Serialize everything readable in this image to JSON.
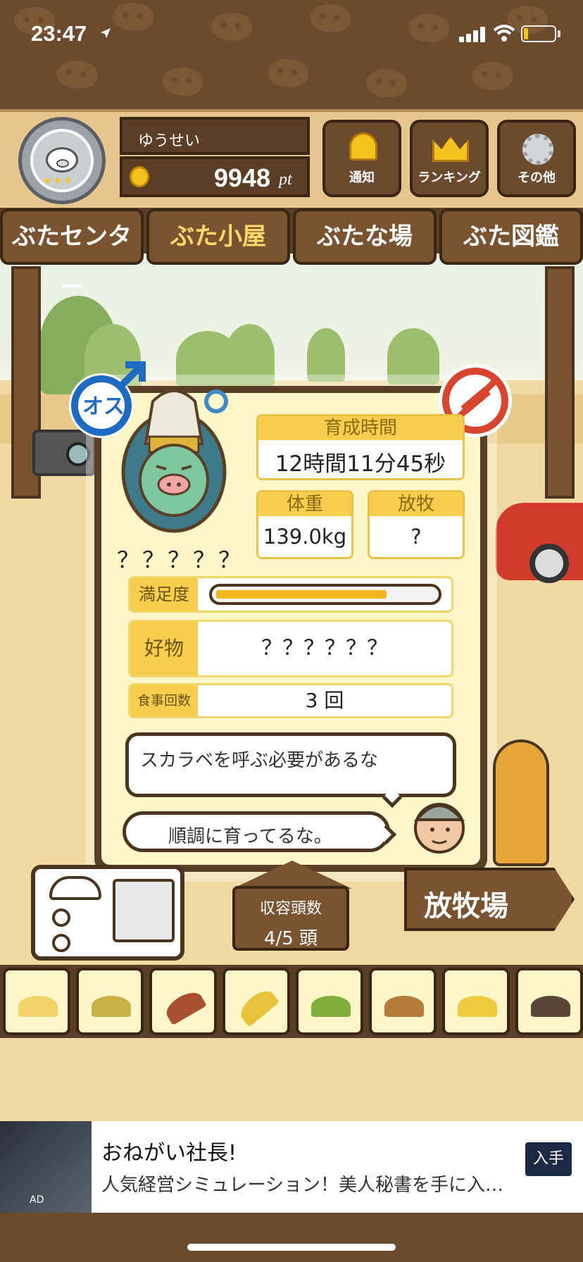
{
  "status_bar": {
    "time": "23:47"
  },
  "header": {
    "username": "ゆうせい",
    "points": "9948",
    "points_unit": "pt",
    "buttons": [
      {
        "label": "通知",
        "icon": "bell-icon"
      },
      {
        "label": "ランキング",
        "icon": "crown-icon"
      },
      {
        "label": "その他",
        "icon": "gear-icon"
      }
    ]
  },
  "tabs": [
    {
      "label": "ぶたセンター",
      "active": false
    },
    {
      "label": "ぶた小屋",
      "active": true
    },
    {
      "label": "ぶたな場",
      "active": false
    },
    {
      "label": "ぶた図鑑",
      "active": false
    }
  ],
  "pig": {
    "gender_label": "オス",
    "name": "？？？？？",
    "growth_time_label": "育成時間",
    "growth_time": "12時間11分45秒",
    "weight_label": "体重",
    "weight": "139.0kg",
    "grazing_label": "放牧",
    "grazing": "?",
    "satisfaction_label": "満足度",
    "satisfaction_level": 0.78,
    "favorite_label": "好物",
    "favorite": "？？？？？？",
    "meals_label": "食事回数",
    "meals": "3 回"
  },
  "dialog": {
    "speech_1": "スカラベを呼ぶ必要があるな",
    "speech_2": "順調に育ってるな。"
  },
  "capacity": {
    "label": "収容頭数",
    "value": "4/5 頭"
  },
  "pasture_sign": "放牧場",
  "feed_items": [
    "yellow-beans-icon",
    "mixed-beans-icon",
    "sweet-potato-icon",
    "corn-icon",
    "herbs-icon",
    "acorn-icon",
    "grain-bowl-icon",
    "dark-balls-icon"
  ],
  "ad": {
    "badge": "AD",
    "title": "おねがい社長!",
    "description": "人気経営シミュレーション！美人秘書を手に入れよう",
    "cta": "入手"
  },
  "colors": {
    "wood_dark": "#5a3f27",
    "panel_bg": "#fdf6c9",
    "accent_yellow": "#f6cd4c",
    "gender_blue": "#1f6bc4",
    "ban_red": "#d8452e"
  }
}
